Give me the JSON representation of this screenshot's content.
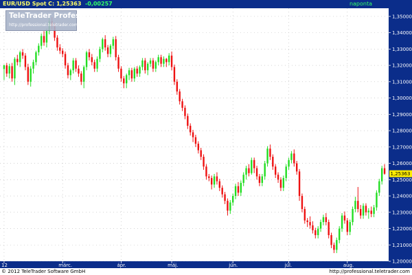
{
  "header": {
    "symbol": "EUR/USD Spot",
    "close_label": "C: 1,25363",
    "change": "-0,00257",
    "interval": "napontа"
  },
  "watermark": {
    "title": "TeleTrader Professional",
    "subtitle": "http://professional.teletrader.com"
  },
  "footer": {
    "copyright": "© 2012 TeleTrader Software GmbH",
    "url": "http://professional.teletrader.com"
  },
  "colors": {
    "up": "#22dd22",
    "down": "#ee1111",
    "header_bg": "#0b2d8a",
    "axis_bg": "#0b2d8a",
    "price_tag": "#ffee00",
    "grid": "#b8b8b8"
  },
  "chart_data": {
    "type": "candlestick",
    "title": "",
    "ylim": [
      1.2,
      1.355
    ],
    "y_ticks": [
      "1,35000",
      "1,34000",
      "1,33000",
      "1,32000",
      "1,31000",
      "1,30000",
      "1,29000",
      "1,28000",
      "1,27000",
      "1,26000",
      "1,25000",
      "1,24000",
      "1,23000",
      "1,22000",
      "1,21000",
      "1,20000"
    ],
    "last_price": "1,25363",
    "grid": true,
    "x_labels": [
      {
        "label": "12",
        "index": 0
      },
      {
        "label": "márc.",
        "index": 22
      },
      {
        "label": "ápr.",
        "index": 44
      },
      {
        "label": "máj.",
        "index": 63
      },
      {
        "label": "jún.",
        "index": 86
      },
      {
        "label": "júl.",
        "index": 107
      },
      {
        "label": "aug.",
        "index": 129
      }
    ],
    "opens": [
      1.3178,
      1.32,
      1.315,
      1.3195,
      1.312,
      1.324,
      1.322,
      1.328,
      1.326,
      1.319,
      1.31,
      1.318,
      1.322,
      1.328,
      1.332,
      1.338,
      1.334,
      1.341,
      1.347,
      1.344,
      1.337,
      1.331,
      1.329,
      1.327,
      1.32,
      1.314,
      1.317,
      1.323,
      1.318,
      1.315,
      1.31,
      1.319,
      1.328,
      1.325,
      1.322,
      1.318,
      1.324,
      1.33,
      1.336,
      1.331,
      1.327,
      1.332,
      1.336,
      1.325,
      1.318,
      1.312,
      1.309,
      1.314,
      1.317,
      1.312,
      1.318,
      1.315,
      1.319,
      1.323,
      1.317,
      1.321,
      1.323,
      1.318,
      1.322,
      1.325,
      1.321,
      1.324,
      1.322,
      1.326,
      1.319,
      1.31,
      1.304,
      1.298,
      1.294,
      1.289,
      1.283,
      1.279,
      1.276,
      1.272,
      1.268,
      1.264,
      1.258,
      1.252,
      1.251,
      1.247,
      1.252,
      1.249,
      1.245,
      1.241,
      1.237,
      1.231,
      1.236,
      1.24,
      1.246,
      1.242,
      1.248,
      1.253,
      1.257,
      1.254,
      1.262,
      1.257,
      1.252,
      1.248,
      1.252,
      1.26,
      1.269,
      1.264,
      1.258,
      1.253,
      1.25,
      1.245,
      1.251,
      1.258,
      1.262,
      1.266,
      1.26,
      1.255,
      1.24,
      1.232,
      1.225,
      1.224,
      1.222,
      1.219,
      1.216,
      1.22,
      1.224,
      1.227,
      1.224,
      1.216,
      1.21,
      1.207,
      1.213,
      1.22,
      1.228,
      1.225,
      1.218,
      1.224,
      1.232,
      1.237,
      1.232,
      1.228,
      1.234,
      1.23,
      1.231,
      1.229,
      1.233,
      1.242,
      1.249,
      1.257
    ],
    "highs": [
      1.3205,
      1.3215,
      1.321,
      1.3215,
      1.325,
      1.3265,
      1.329,
      1.33,
      1.3275,
      1.321,
      1.3195,
      1.3235,
      1.329,
      1.3335,
      1.3395,
      1.341,
      1.3425,
      1.349,
      1.3495,
      1.346,
      1.3385,
      1.333,
      1.3305,
      1.3285,
      1.3215,
      1.318,
      1.3245,
      1.3245,
      1.32,
      1.3165,
      1.32,
      1.329,
      1.33,
      1.327,
      1.3235,
      1.3255,
      1.3315,
      1.337,
      1.3385,
      1.3325,
      1.333,
      1.3375,
      1.338,
      1.3265,
      1.3195,
      1.3135,
      1.315,
      1.3185,
      1.3185,
      1.319,
      1.3195,
      1.32,
      1.3245,
      1.3245,
      1.322,
      1.3245,
      1.3245,
      1.323,
      1.3265,
      1.3265,
      1.3255,
      1.3245,
      1.3275,
      1.3285,
      1.3205,
      1.3115,
      1.3055,
      1.2995,
      1.2955,
      1.2905,
      1.2845,
      1.2805,
      1.2775,
      1.2735,
      1.2695,
      1.2655,
      1.2595,
      1.2535,
      1.2525,
      1.2535,
      1.2545,
      1.2505,
      1.2465,
      1.2425,
      1.2385,
      1.2375,
      1.2415,
      1.2475,
      1.2485,
      1.2495,
      1.2545,
      1.2585,
      1.2595,
      1.2635,
      1.2635,
      1.2585,
      1.2535,
      1.2535,
      1.2615,
      1.2705,
      1.2715,
      1.2655,
      1.2595,
      1.2545,
      1.2515,
      1.2525,
      1.2595,
      1.2635,
      1.2675,
      1.2685,
      1.2615,
      1.2565,
      1.2415,
      1.2335,
      1.2265,
      1.2275,
      1.2245,
      1.2205,
      1.2215,
      1.2255,
      1.2285,
      1.2295,
      1.2255,
      1.2175,
      1.2115,
      1.2145,
      1.2215,
      1.2295,
      1.2305,
      1.2265,
      1.2255,
      1.2335,
      1.2395,
      1.2455,
      1.2345,
      1.2355,
      1.2355,
      1.2325,
      1.2335,
      1.2345,
      1.2435,
      1.2505,
      1.2585,
      1.2595
    ],
    "lows": [
      1.311,
      1.313,
      1.312,
      1.31,
      1.308,
      1.32,
      1.319,
      1.324,
      1.317,
      1.308,
      1.307,
      1.315,
      1.32,
      1.326,
      1.33,
      1.332,
      1.331,
      1.339,
      1.342,
      1.335,
      1.329,
      1.327,
      1.325,
      1.318,
      1.312,
      1.311,
      1.315,
      1.316,
      1.313,
      1.308,
      1.306,
      1.317,
      1.323,
      1.32,
      1.316,
      1.316,
      1.322,
      1.328,
      1.329,
      1.325,
      1.325,
      1.33,
      1.323,
      1.316,
      1.31,
      1.306,
      1.306,
      1.311,
      1.31,
      1.31,
      1.313,
      1.313,
      1.317,
      1.315,
      1.314,
      1.319,
      1.316,
      1.316,
      1.32,
      1.319,
      1.319,
      1.319,
      1.32,
      1.317,
      1.308,
      1.302,
      1.296,
      1.292,
      1.287,
      1.281,
      1.277,
      1.273,
      1.27,
      1.266,
      1.262,
      1.256,
      1.25,
      1.249,
      1.244,
      1.245,
      1.247,
      1.243,
      1.239,
      1.235,
      1.228,
      1.229,
      1.234,
      1.238,
      1.24,
      1.24,
      1.246,
      1.25,
      1.252,
      1.253,
      1.254,
      1.25,
      1.246,
      1.246,
      1.25,
      1.258,
      1.262,
      1.256,
      1.251,
      1.248,
      1.243,
      1.243,
      1.249,
      1.256,
      1.26,
      1.258,
      1.253,
      1.237,
      1.23,
      1.223,
      1.221,
      1.22,
      1.217,
      1.214,
      1.214,
      1.218,
      1.222,
      1.222,
      1.214,
      1.208,
      1.205,
      1.205,
      1.211,
      1.218,
      1.223,
      1.216,
      1.216,
      1.222,
      1.23,
      1.23,
      1.226,
      1.226,
      1.228,
      1.226,
      1.227,
      1.227,
      1.231,
      1.24,
      1.247,
      1.253
    ],
    "closes": [
      1.32,
      1.315,
      1.3195,
      1.312,
      1.324,
      1.322,
      1.328,
      1.326,
      1.319,
      1.31,
      1.318,
      1.322,
      1.328,
      1.332,
      1.338,
      1.334,
      1.341,
      1.347,
      1.344,
      1.337,
      1.331,
      1.329,
      1.327,
      1.32,
      1.314,
      1.317,
      1.323,
      1.318,
      1.315,
      1.31,
      1.319,
      1.328,
      1.325,
      1.322,
      1.318,
      1.324,
      1.33,
      1.336,
      1.331,
      1.327,
      1.332,
      1.336,
      1.325,
      1.318,
      1.312,
      1.309,
      1.314,
      1.317,
      1.312,
      1.318,
      1.315,
      1.319,
      1.323,
      1.317,
      1.321,
      1.323,
      1.318,
      1.322,
      1.325,
      1.321,
      1.324,
      1.322,
      1.326,
      1.319,
      1.31,
      1.304,
      1.298,
      1.294,
      1.289,
      1.283,
      1.279,
      1.276,
      1.272,
      1.268,
      1.264,
      1.258,
      1.252,
      1.251,
      1.247,
      1.252,
      1.249,
      1.245,
      1.241,
      1.237,
      1.231,
      1.236,
      1.24,
      1.246,
      1.242,
      1.248,
      1.253,
      1.257,
      1.254,
      1.262,
      1.257,
      1.252,
      1.248,
      1.252,
      1.26,
      1.269,
      1.264,
      1.258,
      1.253,
      1.25,
      1.245,
      1.251,
      1.258,
      1.262,
      1.266,
      1.26,
      1.255,
      1.24,
      1.232,
      1.225,
      1.224,
      1.222,
      1.219,
      1.216,
      1.22,
      1.224,
      1.227,
      1.224,
      1.216,
      1.21,
      1.207,
      1.213,
      1.22,
      1.228,
      1.225,
      1.218,
      1.224,
      1.232,
      1.237,
      1.232,
      1.228,
      1.234,
      1.23,
      1.231,
      1.229,
      1.233,
      1.242,
      1.249,
      1.257,
      1.2536
    ]
  }
}
